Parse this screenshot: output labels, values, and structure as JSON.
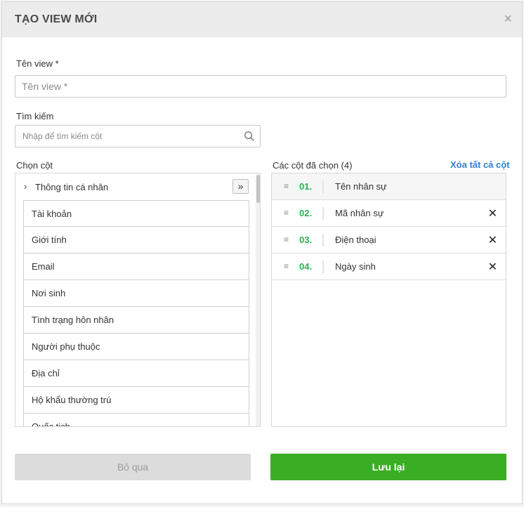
{
  "modal": {
    "title": "TẠO VIEW MỚI",
    "close_icon": "×"
  },
  "view_name": {
    "label": "Tên view *",
    "placeholder": "Tên view *",
    "value": ""
  },
  "search": {
    "label": "Tìm kiếm",
    "placeholder": "Nhập để tìm kiếm cột",
    "icon": "search-icon"
  },
  "available_columns": {
    "label": "Chọn cột",
    "group_label": "Thông tin cá nhân",
    "add_all_icon": "»",
    "items": [
      "Tài khoản",
      "Giới tính",
      "Email",
      "Nơi sinh",
      "Tình trạng hôn nhân",
      "Người phụ thuộc",
      "Địa chỉ",
      "Hộ khẩu thường trú",
      "Quốc tịch"
    ]
  },
  "selected_columns": {
    "label": "Các cột đã chọn (4)",
    "clear_all_label": "Xóa tất cả cột",
    "items": [
      {
        "index": "01.",
        "label": "Tên nhân sự",
        "removable": false
      },
      {
        "index": "02.",
        "label": "Mã nhân sự",
        "removable": true
      },
      {
        "index": "03.",
        "label": "Điện thoại",
        "removable": true
      },
      {
        "index": "04.",
        "label": "Ngày sinh",
        "removable": true
      }
    ],
    "remove_icon": "✕",
    "drag_icon": "≡"
  },
  "footer": {
    "cancel_label": "Bỏ qua",
    "save_label": "Lưu lại"
  },
  "colors": {
    "accent_green": "#3aae23",
    "index_green": "#27b14d",
    "link_blue": "#2f80d1"
  }
}
